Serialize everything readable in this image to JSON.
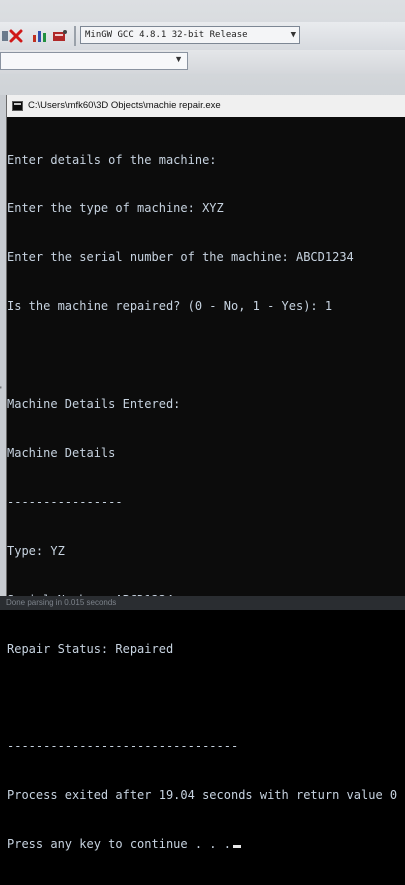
{
  "ide": {
    "compiler": "MinGW GCC 4.8.1 32-bit Release",
    "scope_value": ""
  },
  "console": {
    "window_title": "C:\\Users\\mfk60\\3D Objects\\machie repair.exe",
    "lines": [
      "Enter details of the machine:",
      "Enter the type of machine: XYZ",
      "Enter the serial number of the machine: ABCD1234",
      "Is the machine repaired? (0 - No, 1 - Yes): 1",
      "",
      "Machine Details Entered:",
      "Machine Details",
      "----------------",
      "Type: YZ",
      "Serial Number: ABCD1234",
      "Repair Status: Repaired",
      "",
      "--------------------------------",
      "Process exited after 19.04 seconds with return value 0",
      "Press any key to continue . . ."
    ]
  },
  "statusbar": {
    "text": "Done parsing in 0.015 seconds"
  },
  "colors": {
    "console_bg": "#0c0c0c",
    "console_text": "#c7d3e0",
    "titlebar_bg": "#f0f0f0"
  },
  "icons": [
    "close-red-x-icon",
    "chart-icon",
    "debug-icon",
    "console-app-icon",
    "dropdown-arrow-icon"
  ]
}
